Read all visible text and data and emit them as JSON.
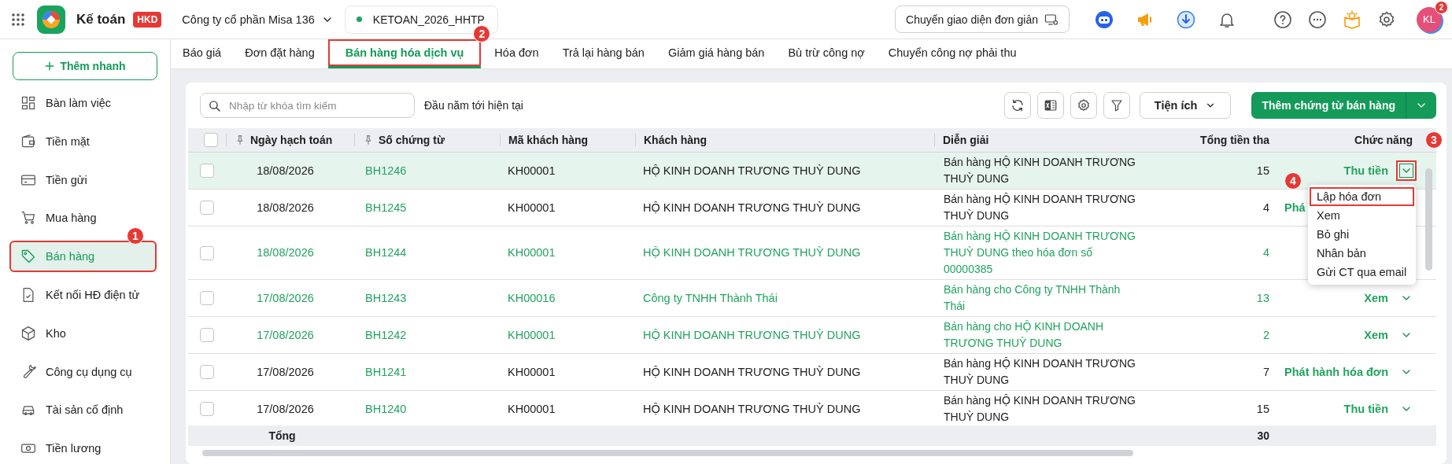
{
  "app": {
    "title": "Kế toán",
    "badge": "HKD",
    "company": "Công ty cổ phần Misa 136",
    "database": "KETOAN_2026_HHTP",
    "simple_mode_button": "Chuyển giao diện đơn giản",
    "notification_count": "2",
    "avatar_initials": "KL"
  },
  "sidebar": {
    "quick_add": "Thêm nhanh",
    "items": [
      {
        "label": "Bàn làm việc",
        "selected": false,
        "highlighted": false
      },
      {
        "label": "Tiền mặt",
        "selected": false,
        "highlighted": false
      },
      {
        "label": "Tiền gửi",
        "selected": false,
        "highlighted": false
      },
      {
        "label": "Mua hàng",
        "selected": false,
        "highlighted": false
      },
      {
        "label": "Bán hàng",
        "selected": true,
        "highlighted": true,
        "marker": "1"
      },
      {
        "label": "Kết nối HĐ điện tử",
        "selected": false,
        "highlighted": false
      },
      {
        "label": "Kho",
        "selected": false,
        "highlighted": false
      },
      {
        "label": "Công cụ dụng cụ",
        "selected": false,
        "highlighted": false
      },
      {
        "label": "Tài sản cố định",
        "selected": false,
        "highlighted": false
      },
      {
        "label": "Tiền lương",
        "selected": false,
        "highlighted": false
      }
    ]
  },
  "tabs": [
    {
      "label": "Báo giá",
      "selected": false,
      "highlighted": false
    },
    {
      "label": "Đơn đặt hàng",
      "selected": false,
      "highlighted": false
    },
    {
      "label": "Bán hàng hóa dịch vụ",
      "selected": true,
      "highlighted": true,
      "marker": "2"
    },
    {
      "label": "Hóa đơn",
      "selected": false,
      "highlighted": false
    },
    {
      "label": "Trả lại hàng bán",
      "selected": false,
      "highlighted": false
    },
    {
      "label": "Giảm giá hàng bán",
      "selected": false,
      "highlighted": false
    },
    {
      "label": "Bù trừ công nợ",
      "selected": false,
      "highlighted": false
    },
    {
      "label": "Chuyển công nợ phải thu",
      "selected": false,
      "highlighted": false
    }
  ],
  "toolbar": {
    "search_placeholder": "Nhập từ khóa tìm kiếm",
    "period": "Đầu năm tới hiện tại",
    "utilities": "Tiện ích",
    "add_button": "Thêm chứng từ bán hàng"
  },
  "table": {
    "select_all_checked": false,
    "columns": [
      {
        "label": "Ngày hạch toán",
        "pinned": true
      },
      {
        "label": "Số chứng từ",
        "pinned": true
      },
      {
        "label": "Mã khách hàng",
        "pinned": false
      },
      {
        "label": "Khách hàng",
        "pinned": false
      },
      {
        "label": "Diễn giải",
        "pinned": false
      },
      {
        "label": "Tổng tiền tha",
        "pinned": false
      },
      {
        "label": "Chức năng",
        "pinned": false,
        "marker": "3"
      }
    ],
    "rows": [
      {
        "date": "18/08/2026",
        "voucher": "BH1246",
        "customer_code": "KH00001",
        "customer": "HỘ KINH DOANH TRƯƠNG THUỲ DUNG",
        "description": "Bán hàng HỘ KINH DOANH TRƯƠNG THUỲ DUNG",
        "total": "15",
        "action": "Thu tiền",
        "caret": true,
        "caret_highlighted": true,
        "checked": false,
        "selected": true,
        "unposted": false
      },
      {
        "date": "18/08/2026",
        "voucher": "BH1245",
        "customer_code": "KH00001",
        "customer": "HỘ KINH DOANH TRƯƠNG THUỲ DUNG",
        "description": "Bán hàng HỘ KINH DOANH TRƯƠNG THUỲ DUNG",
        "total": "4",
        "action": "Phá",
        "caret": false,
        "checked": false,
        "selected": false,
        "unposted": false
      },
      {
        "date": "18/08/2026",
        "voucher": "BH1244",
        "customer_code": "KH00001",
        "customer": "HỘ KINH DOANH TRƯƠNG THUỲ DUNG",
        "description": "Bán hàng HỘ KINH DOANH TRƯƠNG THUỲ DUNG theo hóa đơn số 00000385",
        "total": "4",
        "caret": false,
        "checked": false,
        "selected": false,
        "unposted": true
      },
      {
        "date": "17/08/2026",
        "voucher": "BH1243",
        "customer_code": "KH00016",
        "customer": "Công ty TNHH Thành Thái",
        "description": "Bán hàng cho Công ty TNHH Thành Thái",
        "total": "13",
        "action": "Xem",
        "caret": true,
        "caret_highlighted": false,
        "checked": false,
        "selected": false,
        "unposted": true
      },
      {
        "date": "17/08/2026",
        "voucher": "BH1242",
        "customer_code": "KH00001",
        "customer": "HỘ KINH DOANH TRƯƠNG THUỲ DUNG",
        "description": "Bán hàng cho HỘ KINH DOANH TRƯƠNG THUỲ DUNG",
        "total": "2",
        "action": "Xem",
        "caret": true,
        "caret_highlighted": false,
        "checked": false,
        "selected": false,
        "unposted": true
      },
      {
        "date": "17/08/2026",
        "voucher": "BH1241",
        "customer_code": "KH00001",
        "customer": "HỘ KINH DOANH TRƯƠNG THUỲ DUNG",
        "description": "Bán hàng HỘ KINH DOANH TRƯƠNG THUỲ DUNG",
        "total": "7",
        "action": "Phát hành hóa đơn",
        "caret": true,
        "caret_highlighted": false,
        "checked": false,
        "selected": false,
        "unposted": false
      },
      {
        "date": "17/08/2026",
        "voucher": "BH1240",
        "customer_code": "KH00001",
        "customer": "HỘ KINH DOANH TRƯƠNG THUỲ DUNG",
        "description": "Bán hàng HỘ KINH DOANH TRƯƠNG THUỲ DUNG",
        "total": "15",
        "action": "Thu tiền",
        "caret": true,
        "caret_highlighted": false,
        "checked": false,
        "selected": false,
        "unposted": false
      }
    ],
    "footer": {
      "label": "Tổng",
      "total": "30"
    }
  },
  "action_menu": {
    "items": [
      {
        "label": "Lập hóa đơn",
        "highlighted": true,
        "marker": "4"
      },
      {
        "label": "Xem",
        "highlighted": false
      },
      {
        "label": "Bỏ ghi",
        "highlighted": false
      },
      {
        "label": "Nhân bản",
        "highlighted": false
      },
      {
        "label": "Gửi CT qua email",
        "highlighted": false
      }
    ]
  }
}
